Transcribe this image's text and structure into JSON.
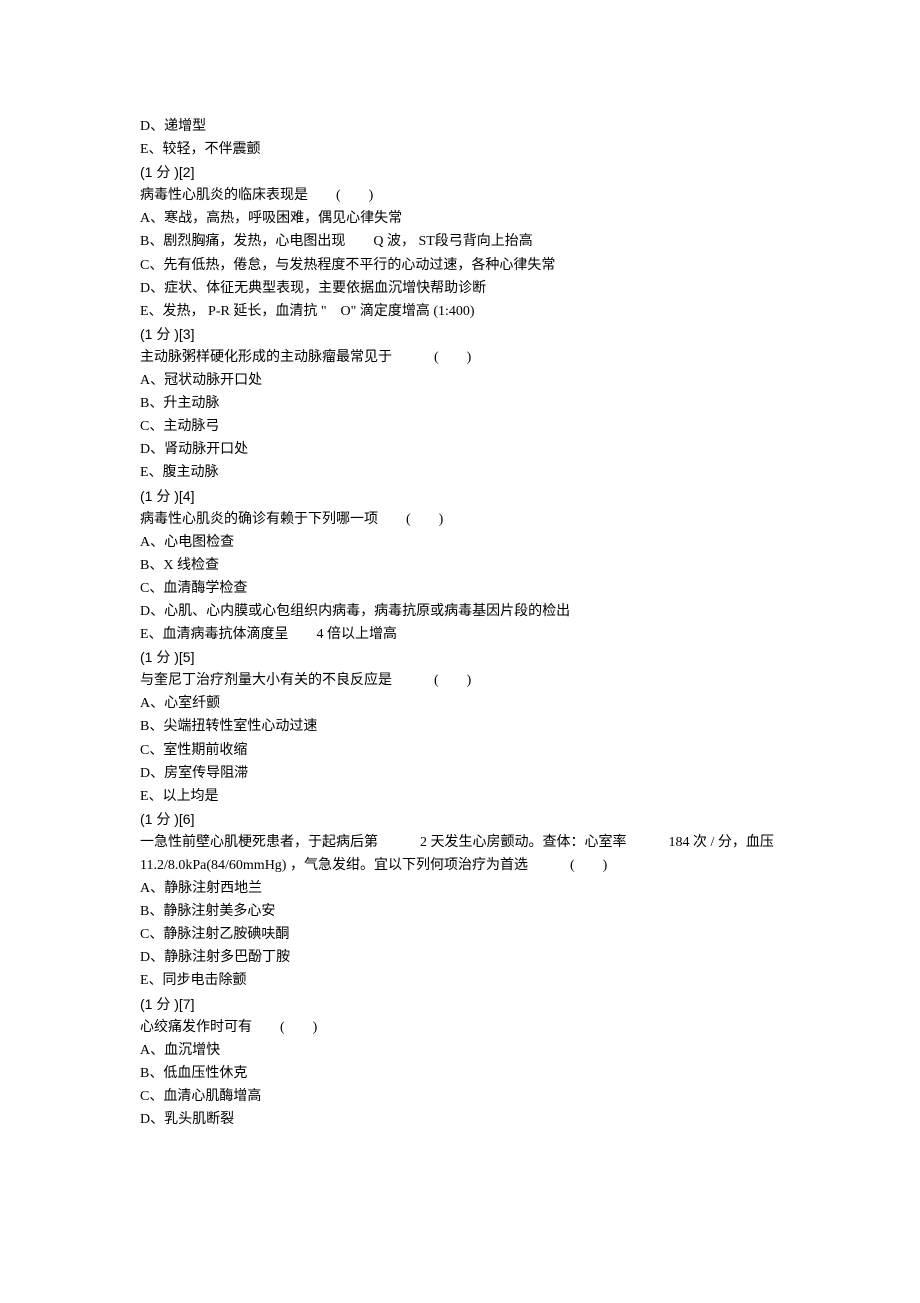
{
  "lines": [
    "D、递增型",
    "E、较轻，不伴震颤",
    "(1 分 )[2]",
    "病毒性心肌炎的临床表现是　　(　　)",
    "A、寒战，高热，呼吸困难，偶见心律失常",
    "B、剧烈胸痛，发热，心电图出现　　Q 波，  ST段弓背向上抬高",
    "C、先有低热，倦怠，与发热程度不平行的心动过速，各种心律失常",
    "D、症状、体征无典型表现，主要依据血沉增快帮助诊断",
    "E、发热，  P-R 延长，血清抗 \"　O\" 滴定度增高  (1:400)",
    "(1 分 )[3]",
    "主动脉粥样硬化形成的主动脉瘤最常见于　　　(　　)",
    "A、冠状动脉开口处",
    "B、升主动脉",
    "C、主动脉弓",
    "D、肾动脉开口处",
    "E、腹主动脉",
    "(1 分 )[4]",
    "病毒性心肌炎的确诊有赖于下列哪一项　　(　　)",
    "A、心电图检查",
    "B、X 线检查",
    "C、血清酶学检查",
    "D、心肌、心内膜或心包组织内病毒，病毒抗原或病毒基因片段的检出",
    "E、血清病毒抗体滴度呈　　4  倍以上增高",
    "(1 分 )[5]",
    "与奎尼丁治疗剂量大小有关的不良反应是　　　(　　)",
    "A、心室纤颤",
    "B、尖端扭转性室性心动过速",
    "C、室性期前收缩",
    "D、房室传导阻滞",
    "E、以上均是",
    "(1 分 )[6]",
    "一急性前壁心肌梗死患者，于起病后第　　　2 天发生心房颤动。查体：心室率　　　184 次 / 分，血压 11.2/8.0kPa(84/60mmHg) ，气急发绀。宜以下列何项治疗为首选　　　(　　)",
    "A、静脉注射西地兰",
    "B、静脉注射美多心安",
    "C、静脉注射乙胺碘呋酮",
    "D、静脉注射多巴酚丁胺",
    "E、同步电击除颤",
    "(1 分 )[7]",
    "心绞痛发作时可有　　(　　)",
    "A、血沉增快",
    "B、低血压性休克",
    "C、血清心肌酶增高",
    "D、乳头肌断裂"
  ]
}
